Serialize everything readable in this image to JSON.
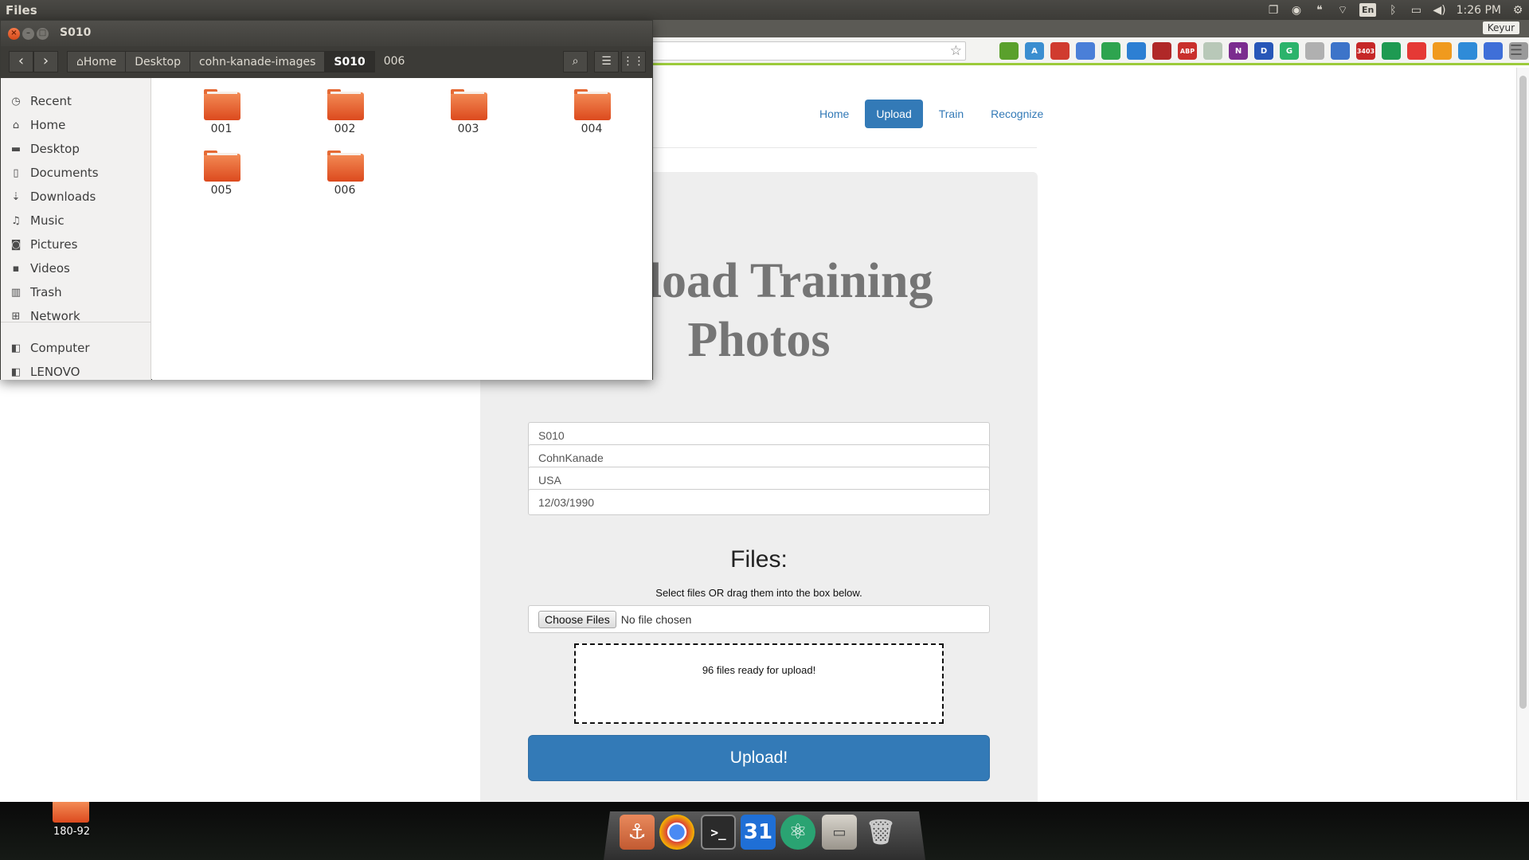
{
  "top_panel": {
    "app_name": "Files",
    "time": "1:26 PM",
    "keyboard_layout": "En",
    "tray_icons": [
      "dropbox-icon",
      "chrome-icon",
      "hangouts-icon",
      "wifi-icon",
      "keyboard-icon",
      "bluetooth-icon",
      "battery-icon",
      "volume-icon",
      "settings-gear-icon"
    ]
  },
  "browser": {
    "profile_name": "Keyur",
    "extensions": [
      {
        "name": "evernote-icon",
        "color": "#5aa02c",
        "label": ""
      },
      {
        "name": "font-icon",
        "color": "#3b8ed0",
        "label": "A"
      },
      {
        "name": "bookmark-red-icon",
        "color": "#d03b2f",
        "label": ""
      },
      {
        "name": "translate-icon",
        "color": "#4a7fd8",
        "label": ""
      },
      {
        "name": "ext-green-icon",
        "color": "#2ea44f",
        "label": ""
      },
      {
        "name": "window-icon",
        "color": "#2d7fd3",
        "label": ""
      },
      {
        "name": "ext-car-icon",
        "color": "#b02828",
        "label": ""
      },
      {
        "name": "adblock-icon",
        "color": "#c9302c",
        "label": "ABP"
      },
      {
        "name": "puzzle-icon",
        "color": "#b8c8b8",
        "label": ""
      },
      {
        "name": "onenote-icon",
        "color": "#7b2c8f",
        "label": "N"
      },
      {
        "name": "ext-d-icon",
        "color": "#2857b8",
        "label": "D"
      },
      {
        "name": "grammarly-icon",
        "color": "#2bb36b",
        "label": "G"
      },
      {
        "name": "ext-grey-icon",
        "color": "#b0b0b0",
        "label": ""
      },
      {
        "name": "ext-stack-icon",
        "color": "#3d74c9",
        "label": ""
      },
      {
        "name": "gmail-icon",
        "color": "#c62828",
        "label": "3403"
      },
      {
        "name": "drive-icon",
        "color": "#1e9a52",
        "label": ""
      },
      {
        "name": "vivaldi-icon",
        "color": "#e53935",
        "label": ""
      },
      {
        "name": "carrot-icon",
        "color": "#f09a1e",
        "label": ""
      },
      {
        "name": "ext-blue-icon",
        "color": "#2f8bd8",
        "label": ""
      },
      {
        "name": "send-icon",
        "color": "#3f6fd8",
        "label": ""
      },
      {
        "name": "image-icon",
        "color": "#9a9a9a",
        "label": ""
      }
    ]
  },
  "page": {
    "nav": [
      "Home",
      "Upload",
      "Train",
      "Recognize"
    ],
    "active_nav": "Upload",
    "title_line1": "Upload Training",
    "title_line2": "Photos",
    "fields": {
      "subject_id": "S010",
      "dataset": "CohnKanade",
      "country": "USA",
      "date": "12/03/1990"
    },
    "files_heading": "Files:",
    "files_hint": "Select files OR drag them into the box below.",
    "choose_files_label": "Choose Files",
    "no_file_chosen": "No file chosen",
    "drop_status": "96 files ready for upload!",
    "upload_button": "Upload!"
  },
  "file_manager": {
    "title": "S010",
    "breadcrumb": [
      "Home",
      "Desktop",
      "cohn-kanade-images",
      "S010",
      "006"
    ],
    "active_crumb": "S010",
    "sidebar": [
      {
        "label": "Recent",
        "icon": "clock-icon"
      },
      {
        "label": "Home",
        "icon": "home-icon"
      },
      {
        "label": "Desktop",
        "icon": "desktop-icon"
      },
      {
        "label": "Documents",
        "icon": "document-icon"
      },
      {
        "label": "Downloads",
        "icon": "download-icon"
      },
      {
        "label": "Music",
        "icon": "music-icon"
      },
      {
        "label": "Pictures",
        "icon": "camera-icon"
      },
      {
        "label": "Videos",
        "icon": "video-icon"
      },
      {
        "label": "Trash",
        "icon": "trash-icon"
      },
      {
        "label": "Network",
        "icon": "network-icon"
      }
    ],
    "devices": [
      {
        "label": "Computer",
        "icon": "drive-icon"
      },
      {
        "label": "LENOVO",
        "icon": "drive-icon"
      }
    ],
    "folders": [
      "001",
      "002",
      "003",
      "004",
      "005",
      "006"
    ]
  },
  "desktop": {
    "item_label": "180-92",
    "dock_icons": [
      "files-anchor-icon",
      "chrome-icon",
      "terminal-icon",
      "calendar-icon",
      "atom-icon",
      "file-manager-icon",
      "trash-icon"
    ],
    "calendar_day": "31"
  }
}
